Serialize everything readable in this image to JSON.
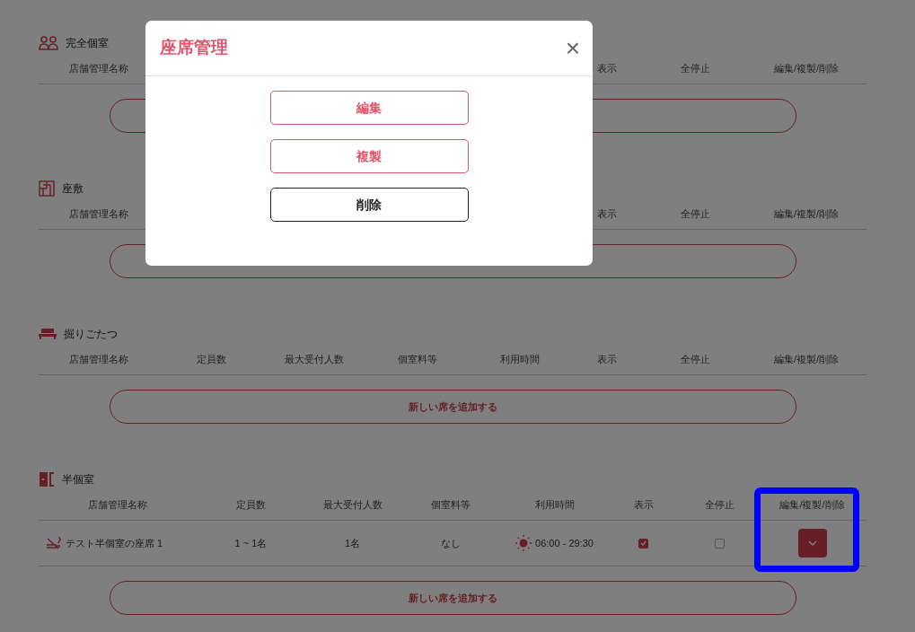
{
  "sections": [
    {
      "title": "完全個室",
      "columns": [
        {
          "label": "店舗管理名称"
        },
        {
          "label": "表示"
        },
        {
          "label": "全停止"
        },
        {
          "label": "編集/複製/削除"
        }
      ]
    },
    {
      "title": "座敷",
      "columns": [
        {
          "label": "店舗管理名称"
        },
        {
          "label": "表示"
        },
        {
          "label": "全停止"
        },
        {
          "label": "編集/複製/削除"
        }
      ]
    },
    {
      "title": "掘りごたつ",
      "columns": [
        {
          "label": "店舗管理名称"
        },
        {
          "label": "定員数"
        },
        {
          "label": "最大受付人数"
        },
        {
          "label": "個室料等"
        },
        {
          "label": "利用時間"
        },
        {
          "label": "表示"
        },
        {
          "label": "全停止"
        },
        {
          "label": "編集/複製/削除"
        }
      ],
      "add_button": {
        "label": "新しい席を追加する"
      }
    },
    {
      "title": "半個室",
      "columns": [
        {
          "label": "店舗管理名称"
        },
        {
          "label": "定員数"
        },
        {
          "label": "最大受付人数"
        },
        {
          "label": "個室料等"
        },
        {
          "label": "利用時間"
        },
        {
          "label": "表示"
        },
        {
          "label": "全停止"
        },
        {
          "label": "編集/複製/削除"
        }
      ],
      "rows": [
        {
          "name": "テスト半個室の座席 1",
          "capacity": "1 ~ 1名",
          "max_guests": "1名",
          "fee": "なし",
          "hours": "06:00 - 29:30",
          "display": true,
          "stopped": false,
          "highlighted": true
        }
      ],
      "add_button": {
        "label": "新しい席を追加する"
      }
    }
  ],
  "dialog": {
    "title": "座席管理",
    "close": "×",
    "buttons": [
      {
        "label": "編集",
        "kind": "accent"
      },
      {
        "label": "複製",
        "kind": "accent"
      },
      {
        "label": "削除",
        "kind": "plain"
      }
    ]
  }
}
